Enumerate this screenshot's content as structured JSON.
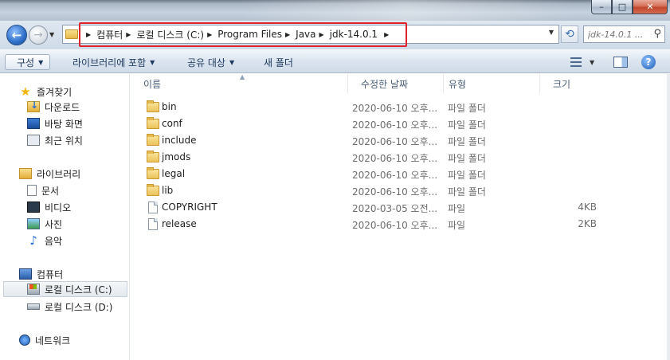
{
  "window": {
    "controls": [
      "–",
      "□",
      "✕"
    ]
  },
  "navigation": {
    "breadcrumb": [
      "컴퓨터",
      "로컬 디스크 (C:)",
      "Program Files",
      "Java",
      "jdk-14.0.1"
    ],
    "search_placeholder": "jdk-14.0.1 ...",
    "back_icon": "back-arrow-icon",
    "forward_icon": "forward-arrow-icon",
    "refresh_icon": "refresh-icon",
    "search_icon": "magnifier-icon"
  },
  "toolbar": {
    "organize": "구성",
    "include_library": "라이브러리에 포함",
    "share": "공유 대상",
    "new_folder": "새 폴더",
    "help": "?"
  },
  "nav_pane": {
    "favorites": "즐겨찾기",
    "downloads": "다운로드",
    "desktop": "바탕 화면",
    "recent": "최근 위치",
    "libraries": "라이브러리",
    "documents": "문서",
    "videos": "비디오",
    "pictures": "사진",
    "music": "음악",
    "computer": "컴퓨터",
    "drive_c": "로컬 디스크 (C:)",
    "drive_d": "로컬 디스크 (D:)",
    "network": "네트워크"
  },
  "columns": {
    "name": "이름",
    "date": "수정한 날짜",
    "type": "유형",
    "size": "크기"
  },
  "files": [
    {
      "name": "bin",
      "date": "2020-06-10 오후...",
      "type": "파일 폴더",
      "size": "",
      "kind": "folder"
    },
    {
      "name": "conf",
      "date": "2020-06-10 오후...",
      "type": "파일 폴더",
      "size": "",
      "kind": "folder"
    },
    {
      "name": "include",
      "date": "2020-06-10 오후...",
      "type": "파일 폴더",
      "size": "",
      "kind": "folder"
    },
    {
      "name": "jmods",
      "date": "2020-06-10 오후...",
      "type": "파일 폴더",
      "size": "",
      "kind": "folder"
    },
    {
      "name": "legal",
      "date": "2020-06-10 오후...",
      "type": "파일 폴더",
      "size": "",
      "kind": "folder"
    },
    {
      "name": "lib",
      "date": "2020-06-10 오후...",
      "type": "파일 폴더",
      "size": "",
      "kind": "folder"
    },
    {
      "name": "COPYRIGHT",
      "date": "2020-03-05 오전...",
      "type": "파일",
      "size": "4KB",
      "kind": "file"
    },
    {
      "name": "release",
      "date": "2020-06-10 오후...",
      "type": "파일",
      "size": "2KB",
      "kind": "file"
    }
  ],
  "colors": {
    "highlight_border": "#e0222a",
    "header_text": "#4c607a",
    "folder_yellow": "#ecc25a"
  }
}
